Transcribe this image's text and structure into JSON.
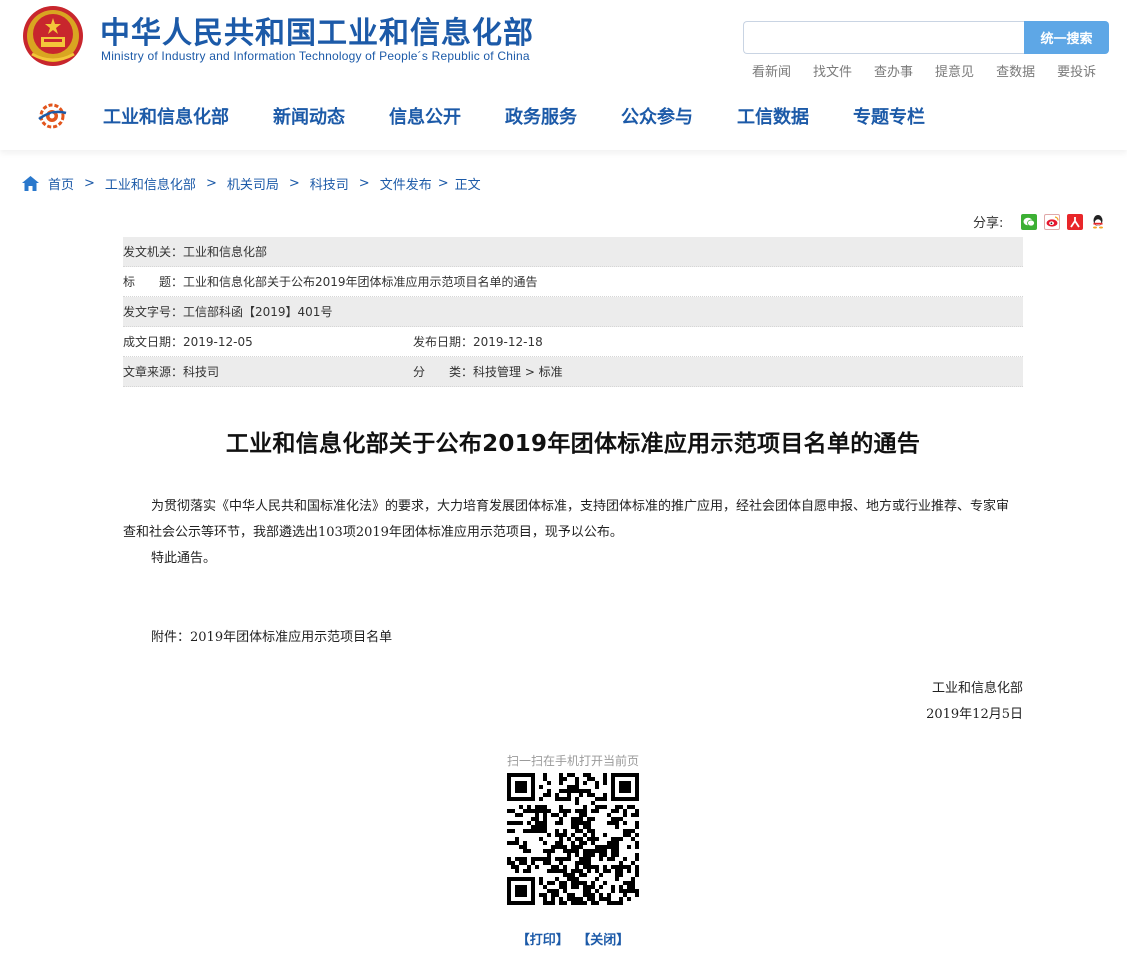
{
  "header": {
    "site_title": "中华人民共和国工业和信息化部",
    "site_subtitle": "Ministry of Industry and Information Technology of People´s Republic of China",
    "search_placeholder": "",
    "search_button": "统一搜索",
    "quick_links": [
      "看新闻",
      "找文件",
      "查办事",
      "提意见",
      "查数据",
      "要投诉"
    ]
  },
  "nav": {
    "items": [
      "工业和信息化部",
      "新闻动态",
      "信息公开",
      "政务服务",
      "公众参与",
      "工信数据",
      "专题专栏"
    ]
  },
  "breadcrumb": {
    "items": [
      "首页",
      "工业和信息化部",
      "机关司局",
      "科技司",
      "文件发布"
    ],
    "separator": ">",
    "current": "正文"
  },
  "share": {
    "label": "分享:",
    "icons": [
      "wechat-icon",
      "weibo-icon",
      "renren-icon",
      "qq-icon"
    ]
  },
  "meta": {
    "issuer": "发文机关：工业和信息化部",
    "title": "标　　题：工业和信息化部关于公布2019年团体标准应用示范项目名单的通告",
    "doc_number": "发文字号：工信部科函【2019】401号",
    "created": "成文日期：2019-12-05",
    "published": "发布日期：2019-12-18",
    "source": "文章来源：科技司",
    "category": "分　　类：科技管理 > 标准"
  },
  "article": {
    "title": "工业和信息化部关于公布2019年团体标准应用示范项目名单的通告",
    "paragraph1": "为贯彻落实《中华人民共和国标准化法》的要求，大力培育发展团体标准，支持团体标准的推广应用，经社会团体自愿申报、地方或行业推荐、专家审查和社会公示等环节，我部遴选出103项2019年团体标准应用示范项目，现予以公布。",
    "paragraph2": "特此通告。",
    "attachment": "附件：2019年团体标准应用示范项目名单",
    "signature_org": "工业和信息化部",
    "signature_date": "2019年12月5日"
  },
  "qr": {
    "label": "扫一扫在手机打开当前页"
  },
  "actions": {
    "print": "【打印】",
    "close": "【关闭】"
  },
  "colors": {
    "brand_blue": "#1c5aa8",
    "search_button": "#5ea7e6",
    "meta_shade": "#ececec"
  }
}
